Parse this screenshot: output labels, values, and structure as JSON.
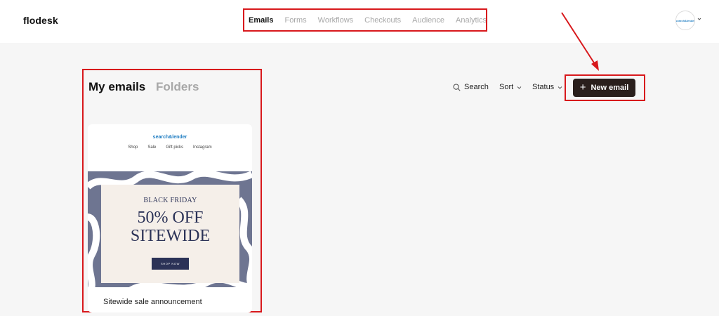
{
  "app": {
    "logo": "flodesk"
  },
  "nav": {
    "items": [
      {
        "label": "Emails",
        "active": true
      },
      {
        "label": "Forms",
        "active": false
      },
      {
        "label": "Workflows",
        "active": false
      },
      {
        "label": "Checkouts",
        "active": false
      },
      {
        "label": "Audience",
        "active": false
      },
      {
        "label": "Analytics",
        "active": false
      }
    ]
  },
  "account": {
    "avatar_text": "search&lender",
    "icon": "chevron-down-icon"
  },
  "main": {
    "tabs": {
      "my_emails": "My emails",
      "folders": "Folders"
    },
    "toolbar": {
      "search": "Search",
      "sort": "Sort",
      "status": "Status",
      "new_email": "New email"
    }
  },
  "email_card": {
    "brand": "search&lender",
    "links": [
      "Shop",
      "Sale",
      "Gift picks",
      "Instagram"
    ],
    "promo": {
      "kicker": "BLACK FRIDAY",
      "line1": "50% OFF",
      "line2": "SITEWIDE",
      "cta": "SHOP NOW"
    },
    "title": "Sitewide sale announcement"
  },
  "colors": {
    "annotation": "#d8181c",
    "primary_button": "#2a1f1c",
    "hero_bg": "#6e7591",
    "promo_text": "#2b3257"
  }
}
